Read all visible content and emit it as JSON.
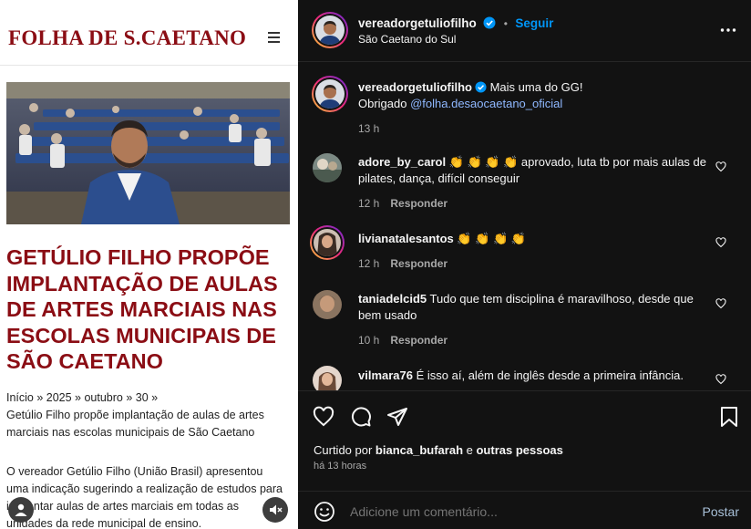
{
  "news": {
    "logo": "FOLHA DE S.CAETANO",
    "headline": "GETÚLIO FILHO PROPÕE IMPLANTAÇÃO DE AULAS DE ARTES MARCIAIS NAS ESCOLAS MUNICIPAIS DE SÃO CAETANO",
    "breadcrumbs": "Início » 2025 » outubro » 30 »",
    "subtitle": "Getúlio Filho propõe implantação de aulas de artes marciais nas escolas municipais de São Caetano",
    "body": "O vereador Getúlio Filho (União Brasil) apresentou uma indicação sugerindo a realização de estudos para implantar aulas de artes marciais em todas as unidades da rede municipal de ensino."
  },
  "post": {
    "author": "vereadorgetuliofilho",
    "follow_label": "Seguir",
    "location": "São Caetano do Sul",
    "caption_line1": "Mais uma do GG!",
    "caption_line2_prefix": "Obrigado ",
    "caption_mention": "@folha.desaocaetano_oficial",
    "caption_time": "13 h",
    "reply_label": "Responder",
    "comments": [
      {
        "user": "adore_by_carol",
        "text": "👏 👏 👏 👏 aprovado, luta tb por mais aulas de pilates, dança, difícil conseguir",
        "time": "12 h"
      },
      {
        "user": "livianatalesantos",
        "text": "👏 👏 👏 👏",
        "time": "12 h"
      },
      {
        "user": "taniadelcid5",
        "text": "Tudo que tem disciplina é maravilhoso, desde que bem usado",
        "time": "10 h"
      },
      {
        "user": "vilmara76",
        "text": "É isso aí, além de inglês desde a primeira infância.",
        "time": ""
      }
    ],
    "liked_prefix": "Curtido por ",
    "liked_user": "bianca_bufarah",
    "liked_mid": " e ",
    "liked_others": "outras pessoas",
    "posted_ago": "há 13 horas",
    "comment_placeholder": "Adicione um comentário...",
    "post_label": "Postar"
  },
  "colors": {
    "brand_red": "#8b0d14",
    "ig_blue": "#0095f6",
    "ig_bg": "#121212"
  }
}
